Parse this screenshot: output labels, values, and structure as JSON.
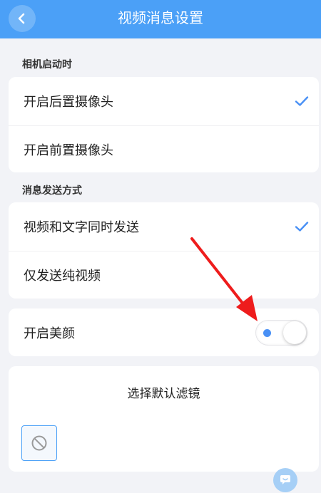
{
  "header": {
    "title": "视频消息设置",
    "back_icon": "chevron-left-icon"
  },
  "camera_section": {
    "label": "相机启动时",
    "options": [
      {
        "label": "开启后置摄像头",
        "selected": true
      },
      {
        "label": "开启前置摄像头",
        "selected": false
      }
    ]
  },
  "send_section": {
    "label": "消息发送方式",
    "options": [
      {
        "label": "视频和文字同时发送",
        "selected": true
      },
      {
        "label": "仅发送纯视频",
        "selected": false
      }
    ]
  },
  "beauty": {
    "label": "开启美颜",
    "enabled": false
  },
  "filter": {
    "title": "选择默认滤镜",
    "none_icon": "no-filter-icon"
  },
  "colors": {
    "accent": "#4ba0f7",
    "check": "#4990f5",
    "arrow": "#ee1c1c"
  }
}
